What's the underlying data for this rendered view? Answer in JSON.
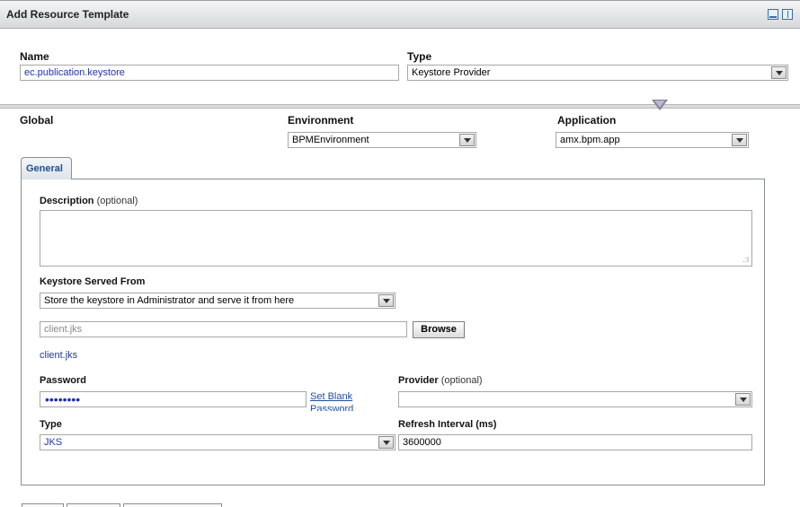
{
  "window": {
    "title": "Add Resource Template"
  },
  "form": {
    "name_label": "Name",
    "name_value": "ec.publication.keystore",
    "type_label": "Type",
    "type_value": "Keystore Provider"
  },
  "scope": {
    "global_label": "Global",
    "environment_label": "Environment",
    "environment_value": "BPMEnvironment",
    "application_label": "Application",
    "application_value": "amx.bpm.app"
  },
  "tabs": [
    {
      "label": "General"
    }
  ],
  "general": {
    "description_label": "Description",
    "description_optional": "(optional)",
    "description_value": "",
    "keystore_served_label": "Keystore Served From",
    "keystore_served_value": "Store the keystore in Administrator and serve it from here",
    "file_placeholder": "client.jks",
    "browse_label": "Browse",
    "file_link": "client.jks",
    "password_label": "Password",
    "password_masked": "••••••••",
    "set_blank_label": "Set Blank",
    "set_blank_label_cont": "Password",
    "provider_label": "Provider",
    "provider_optional": "(optional)",
    "provider_value": "",
    "type_label": "Type",
    "type_value": "JKS",
    "refresh_label": "Refresh Interval (ms)",
    "refresh_value": "3600000"
  }
}
